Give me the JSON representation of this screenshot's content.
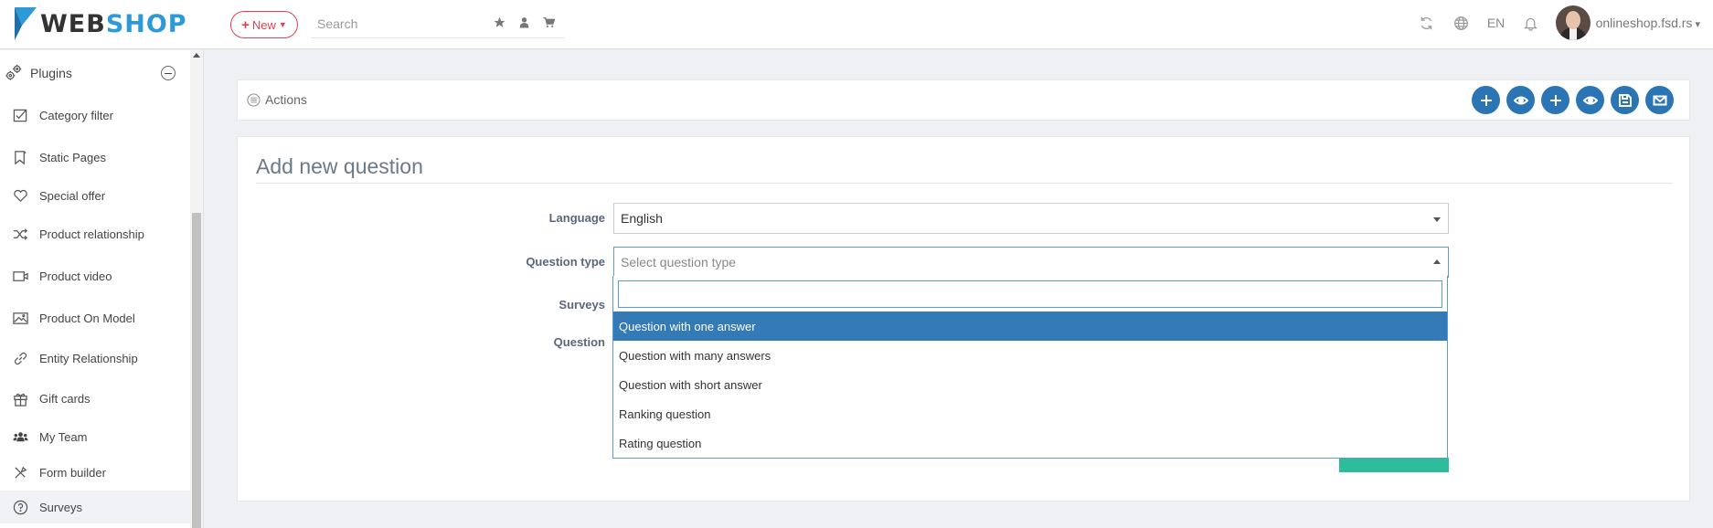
{
  "header": {
    "logo_text_dark": "WEB",
    "logo_text_accent": "SHOP",
    "new_button": "New",
    "search_placeholder": "Search",
    "language": "EN",
    "user": "onlineshop.fsd.rs"
  },
  "sidebar": {
    "section_title": "Plugins",
    "items": [
      {
        "label": "Category filter",
        "icon": "checkbox-icon"
      },
      {
        "label": "Static Pages",
        "icon": "bookmark-icon"
      },
      {
        "label": "Special offer",
        "icon": "heart-icon"
      },
      {
        "label": "Product relationship",
        "icon": "shuffle-icon"
      },
      {
        "label": "Product video",
        "icon": "video-icon"
      },
      {
        "label": "Product On Model",
        "icon": "image-icon"
      },
      {
        "label": "Entity Relationship",
        "icon": "link-icon"
      },
      {
        "label": "Gift cards",
        "icon": "gift-icon"
      },
      {
        "label": "My Team",
        "icon": "team-icon"
      },
      {
        "label": "Form builder",
        "icon": "tools-icon"
      },
      {
        "label": "Surveys",
        "icon": "question-circle-icon",
        "active": true
      }
    ]
  },
  "actions": {
    "label": "Actions",
    "buttons": [
      "plus-icon",
      "eye-icon",
      "plus-icon",
      "eye-icon",
      "save-icon",
      "envelope-icon"
    ]
  },
  "form": {
    "title": "Add new question",
    "labels": {
      "language": "Language",
      "question_type": "Question type",
      "surveys": "Surveys",
      "question": "Question"
    },
    "language_value": "English",
    "question_type_placeholder": "Select question type"
  },
  "dropdown": {
    "search_value": "",
    "options": [
      {
        "label": "Question with one answer",
        "selected": true
      },
      {
        "label": "Question with many answers",
        "selected": false
      },
      {
        "label": "Question with short answer",
        "selected": false
      },
      {
        "label": "Ranking question",
        "selected": false
      },
      {
        "label": "Rating question",
        "selected": false
      }
    ]
  },
  "colors": {
    "accent_blue": "#2c75b5",
    "selected_option": "#337ab7",
    "new_button_red": "#e0404f",
    "submit_green": "#2fbc9c"
  }
}
